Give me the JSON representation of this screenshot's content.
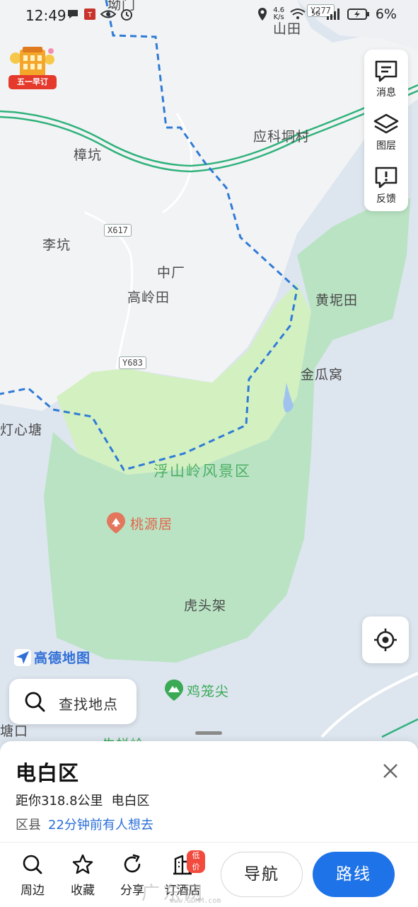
{
  "status_bar": {
    "time": "12:49",
    "net_speed_value": "4.6",
    "net_speed_unit": "K/s",
    "network": "5G",
    "battery": "6%"
  },
  "promo": {
    "label": "五一早订"
  },
  "map": {
    "labels": {
      "top_partial": "坳门",
      "shantian": "山田",
      "yingketongcun": "应科垌村",
      "zhangkeng": "樟坑",
      "likeng": "李坑",
      "zhongchang": "中厂",
      "gaolingtian": "高岭田",
      "huangnitian": "黄坭田",
      "jingua_wo": "金瓜窝",
      "dengxintang": "灯心塘",
      "scenic_area": "浮山岭风景区",
      "taoyuanju": "桃源居",
      "hutoujia": "虎头架",
      "jilongjian": "鸡笼尖",
      "tangkou": "塘口",
      "bottom_partial": "牛栏岭"
    },
    "road_badges": {
      "x617": "X617",
      "y683": "Y683",
      "y277": "Y277"
    },
    "colors": {
      "background_blue": "#dde5ef",
      "land_grey": "#f1f2f4",
      "park_green": "#b9e3c3",
      "park_light": "#d2f0c0",
      "boundary": "#2f7bd6",
      "highway": "#2fb27b"
    }
  },
  "side_panel": {
    "messages": "消息",
    "layers": "图层",
    "feedback": "反馈"
  },
  "brand": "高德地图",
  "search": {
    "label": "查找地点"
  },
  "place": {
    "title": "电白区",
    "distance": "距你318.8公里",
    "district": "电白区",
    "category": "区县",
    "popularity": "22分钟前有人想去"
  },
  "actions": {
    "nearby": "周边",
    "favorite": "收藏",
    "share": "分享",
    "hotel": "订酒店",
    "hotel_badge": "低价",
    "navigate": "导航",
    "route": "路线"
  },
  "watermark": {
    "text": "广东网",
    "sub": "www.GDMM.com"
  }
}
